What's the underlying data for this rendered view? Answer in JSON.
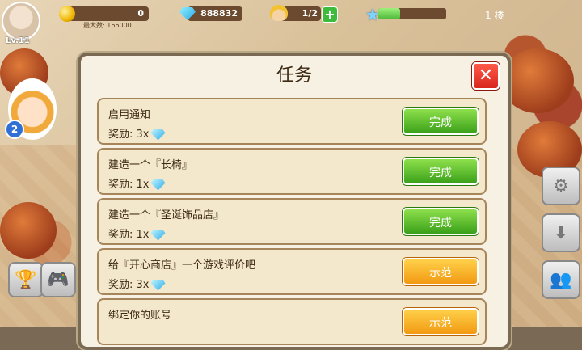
{
  "hud": {
    "level": "Lv.11",
    "coins": "0",
    "max_label": "最大数: 166000",
    "gems": "888832",
    "workers": "1/2",
    "floor": "1 楼",
    "xp_progress": 0.32
  },
  "dialog": {
    "title": "任务",
    "close_label": "✕",
    "reward_prefix": "奖励:",
    "tasks": [
      {
        "name": "启用通知",
        "reward": "3x",
        "action": "完成",
        "action_color": "green"
      },
      {
        "name": "建造一个『长椅』",
        "reward": "1x",
        "action": "完成",
        "action_color": "green"
      },
      {
        "name": "建造一个『圣诞饰品店』",
        "reward": "1x",
        "action": "完成",
        "action_color": "green"
      },
      {
        "name": "给『开心商店』一个游戏评价吧",
        "reward": "3x",
        "action": "示范",
        "action_color": "orange"
      },
      {
        "name": "绑定你的账号",
        "reward": "",
        "action": "示范",
        "action_color": "orange"
      }
    ]
  },
  "side": {
    "char_badge": "2"
  },
  "icons": {
    "coin": "coin-icon",
    "gem": "gem-icon",
    "worker": "worker-icon",
    "star": "star-icon",
    "trophy": "trophy-icon",
    "gamepad": "gamepad-icon",
    "settings": "gear-icon",
    "download": "download-icon",
    "friends": "friends-icon"
  }
}
